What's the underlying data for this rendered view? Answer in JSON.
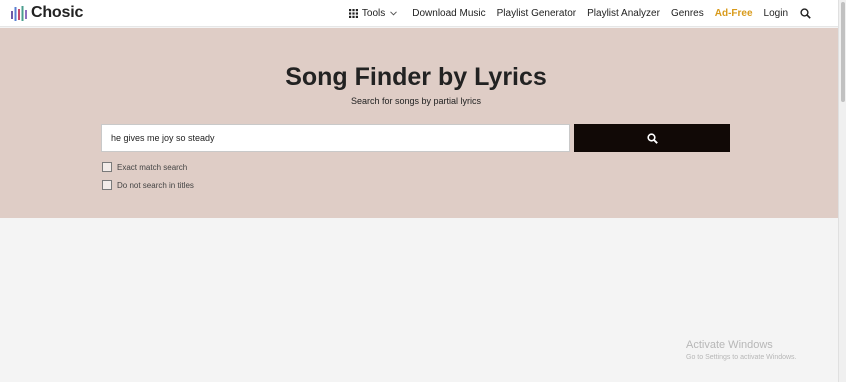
{
  "app": {
    "logo_text": "Chosic"
  },
  "nav": {
    "tools_label": "Tools",
    "items": [
      "Download Music",
      "Playlist Generator",
      "Playlist Analyzer",
      "Genres"
    ],
    "adfree_label": "Ad-Free",
    "login_label": "Login"
  },
  "hero": {
    "title": "Song Finder by Lyrics",
    "subtitle": "Search for songs by partial lyrics"
  },
  "search": {
    "value": "he gives me joy so steady"
  },
  "options": {
    "exact_match_label": "Exact match search",
    "exact_match_checked": false,
    "no_titles_label": "Do not search in titles",
    "no_titles_checked": false
  },
  "watermark": {
    "line1": "Activate Windows",
    "line2": "Go to Settings to activate Windows."
  },
  "colors": {
    "hero_bg": "#dfcdc6",
    "button_bg": "#110906",
    "adfree": "#d89a1a"
  }
}
